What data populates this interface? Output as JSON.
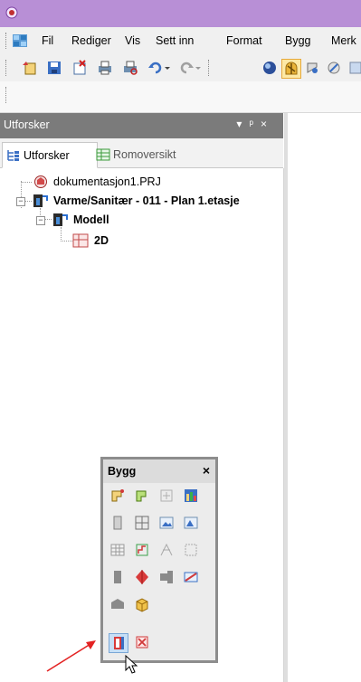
{
  "menu": [
    "Fil",
    "Rediger",
    "Vis",
    "Sett inn",
    "Format",
    "Bygg",
    "Merk"
  ],
  "panel": {
    "title": "Utforsker"
  },
  "tabs": {
    "explorer": "Utforsker",
    "rooms": "Romoversikt"
  },
  "tree": {
    "project": "dokumentasjon1.PRJ",
    "drawing": "Varme/Sanitær - 011 - Plan 1.etasje",
    "model": "Modell",
    "view": "2D"
  },
  "bygg": {
    "title": "Bygg",
    "close": "×"
  },
  "colors": {
    "titlebar": "#b88fd6",
    "panel_header": "#7b7b7b",
    "arrow": "#e32222"
  }
}
